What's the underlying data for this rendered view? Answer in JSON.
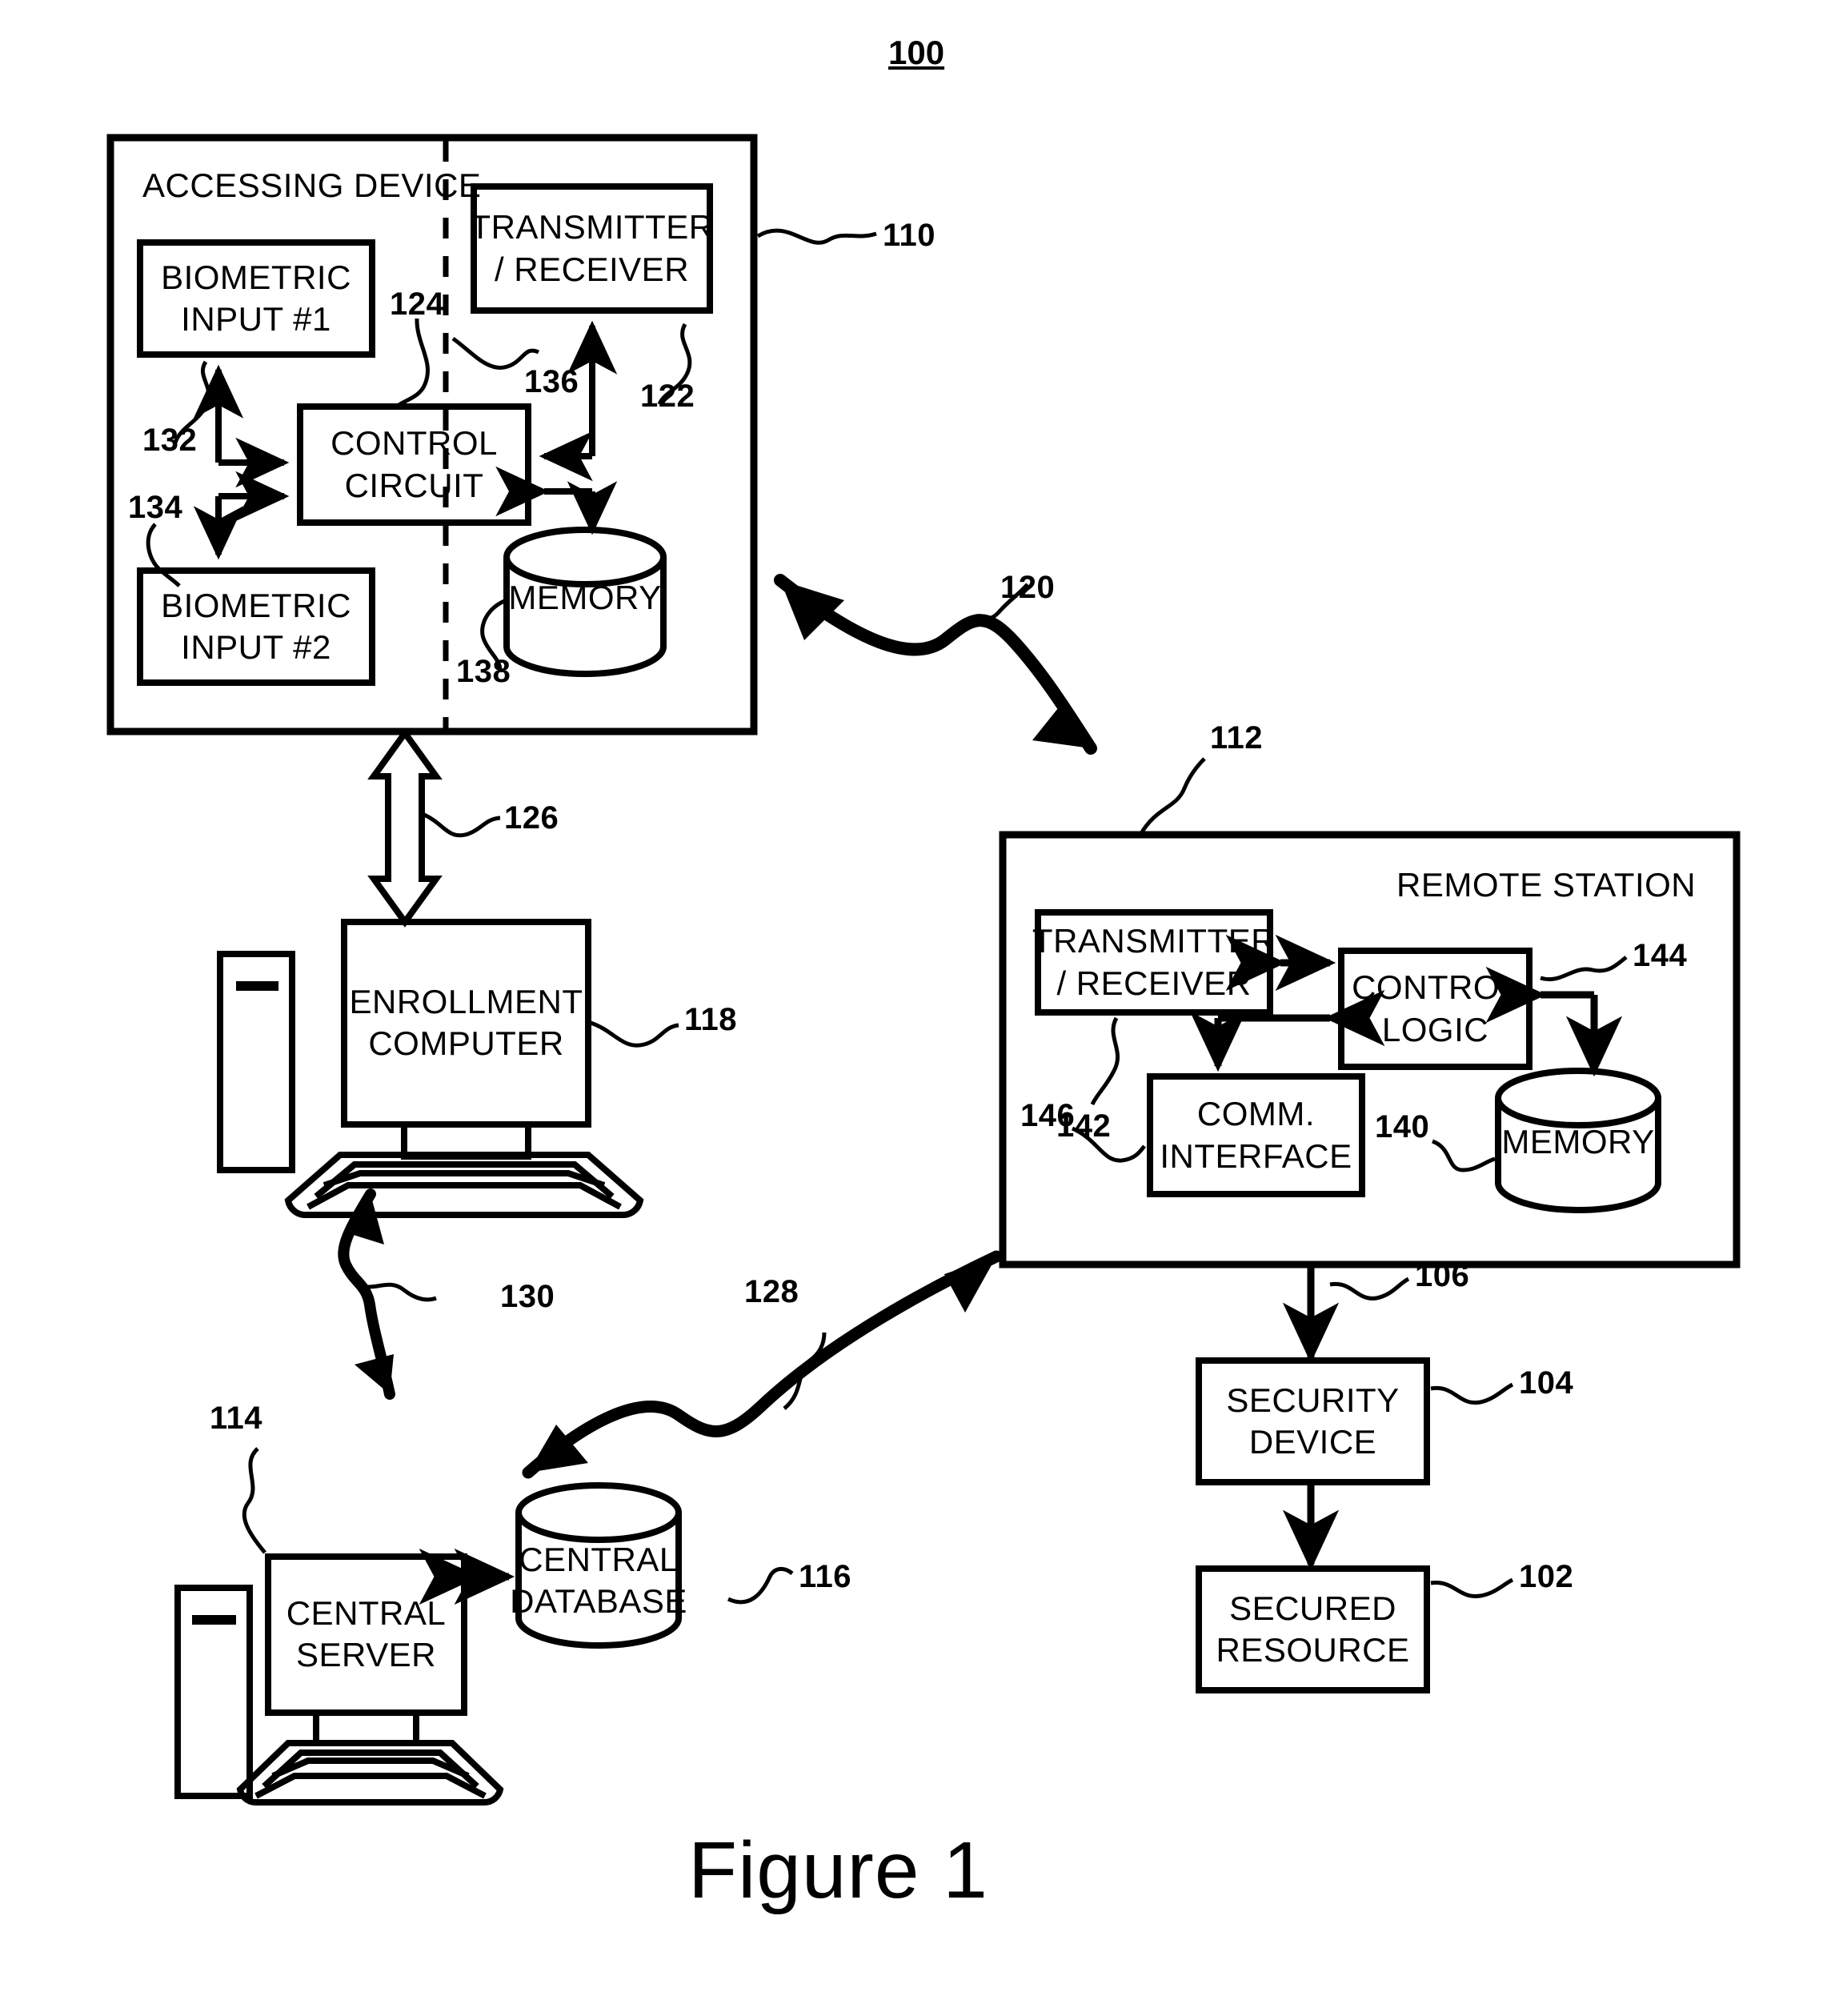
{
  "figure": {
    "system_number": "100",
    "caption": "Figure 1"
  },
  "accessing_device": {
    "title": "ACCESSING DEVICE",
    "ref": "110",
    "blocks": [
      {
        "label": "BIOMETRIC\nINPUT #1",
        "ref": "132"
      },
      {
        "label": "BIOMETRIC\nINPUT #2",
        "ref": "134"
      },
      {
        "label": "CONTROL\nCIRCUIT",
        "ref": "124"
      },
      {
        "label": "TRANSMITTER\n/ RECEIVER",
        "ref": "122"
      },
      {
        "label": "MEMORY",
        "ref": "138"
      }
    ],
    "biometric_input_1": "BIOMETRIC",
    "biometric_input_1_line2": "INPUT #1",
    "biometric_input_2": "BIOMETRIC",
    "biometric_input_2_line2": "INPUT #2",
    "control_circuit_line1": "CONTROL",
    "control_circuit_line2": "CIRCUIT",
    "transmitter_line1": "TRANSMITTER",
    "transmitter_line2": "/ RECEIVER",
    "memory": "MEMORY",
    "ref_110": "110",
    "ref_122": "122",
    "ref_124": "124",
    "ref_132": "132",
    "ref_134": "134",
    "ref_136": "136",
    "ref_138": "138"
  },
  "links": {
    "wireless_accessing_to_remote": "120",
    "enrollment_link": "126",
    "server_to_remote": "128",
    "enrollment_to_server": "130",
    "remote_to_security": "106"
  },
  "enrollment": {
    "label_line1": "ENROLLMENT",
    "label_line2": "COMPUTER",
    "ref": "118"
  },
  "central": {
    "server_line1": "CENTRAL",
    "server_line2": "SERVER",
    "server_ref": "114",
    "database_line1": "CENTRAL",
    "database_line2": "DATABASE",
    "database_ref": "116"
  },
  "remote_station": {
    "title": "REMOTE STATION",
    "ref": "112",
    "transmitter_line1": "TRANSMITTER",
    "transmitter_line2": "/ RECEIVER",
    "transmitter_ref": "142",
    "control_logic_line1": "CONTROL",
    "control_logic_line2": "LOGIC",
    "control_logic_ref": "144",
    "comm_interface_line1": "COMM.",
    "comm_interface_line2": "INTERFACE",
    "comm_interface_ref": "146",
    "memory": "MEMORY",
    "memory_ref": "140"
  },
  "security": {
    "device_line1": "SECURITY",
    "device_line2": "DEVICE",
    "device_ref": "104",
    "resource_line1": "SECURED",
    "resource_line2": "RESOURCE",
    "resource_ref": "102",
    "link_ref": "106"
  },
  "colors": {
    "ink": "#000000",
    "paper": "#ffffff"
  }
}
